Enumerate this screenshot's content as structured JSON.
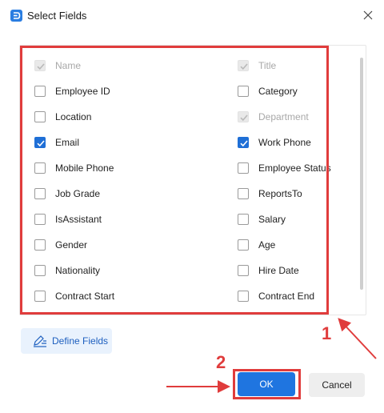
{
  "dialog": {
    "title": "Select Fields"
  },
  "fields": [
    {
      "label": "Name",
      "checked": true,
      "disabled": true
    },
    {
      "label": "Title",
      "checked": true,
      "disabled": true
    },
    {
      "label": "Employee ID",
      "checked": false,
      "disabled": false
    },
    {
      "label": "Category",
      "checked": false,
      "disabled": false
    },
    {
      "label": "Location",
      "checked": false,
      "disabled": false
    },
    {
      "label": "Department",
      "checked": true,
      "disabled": true
    },
    {
      "label": "Email",
      "checked": true,
      "disabled": false
    },
    {
      "label": "Work Phone",
      "checked": true,
      "disabled": false
    },
    {
      "label": "Mobile Phone",
      "checked": false,
      "disabled": false
    },
    {
      "label": "Employee Status",
      "checked": false,
      "disabled": false
    },
    {
      "label": "Job Grade",
      "checked": false,
      "disabled": false
    },
    {
      "label": "ReportsTo",
      "checked": false,
      "disabled": false
    },
    {
      "label": "IsAssistant",
      "checked": false,
      "disabled": false
    },
    {
      "label": "Salary",
      "checked": false,
      "disabled": false
    },
    {
      "label": "Gender",
      "checked": false,
      "disabled": false
    },
    {
      "label": "Age",
      "checked": false,
      "disabled": false
    },
    {
      "label": "Nationality",
      "checked": false,
      "disabled": false
    },
    {
      "label": "Hire Date",
      "checked": false,
      "disabled": false
    },
    {
      "label": "Contract Start",
      "checked": false,
      "disabled": false
    },
    {
      "label": "Contract End",
      "checked": false,
      "disabled": false
    }
  ],
  "buttons": {
    "define_fields": "Define Fields",
    "ok": "OK",
    "cancel": "Cancel"
  },
  "annotations": {
    "step1": "1",
    "step2": "2"
  },
  "colors": {
    "accent": "#1f75e0",
    "checkbox_checked": "#1f6fd6",
    "annotation": "#e03c3c",
    "define_button_bg": "#e9f2fd"
  },
  "icons": {
    "app": "app-logo-icon",
    "close": "close-icon",
    "define_fields": "edit-fields-icon"
  }
}
